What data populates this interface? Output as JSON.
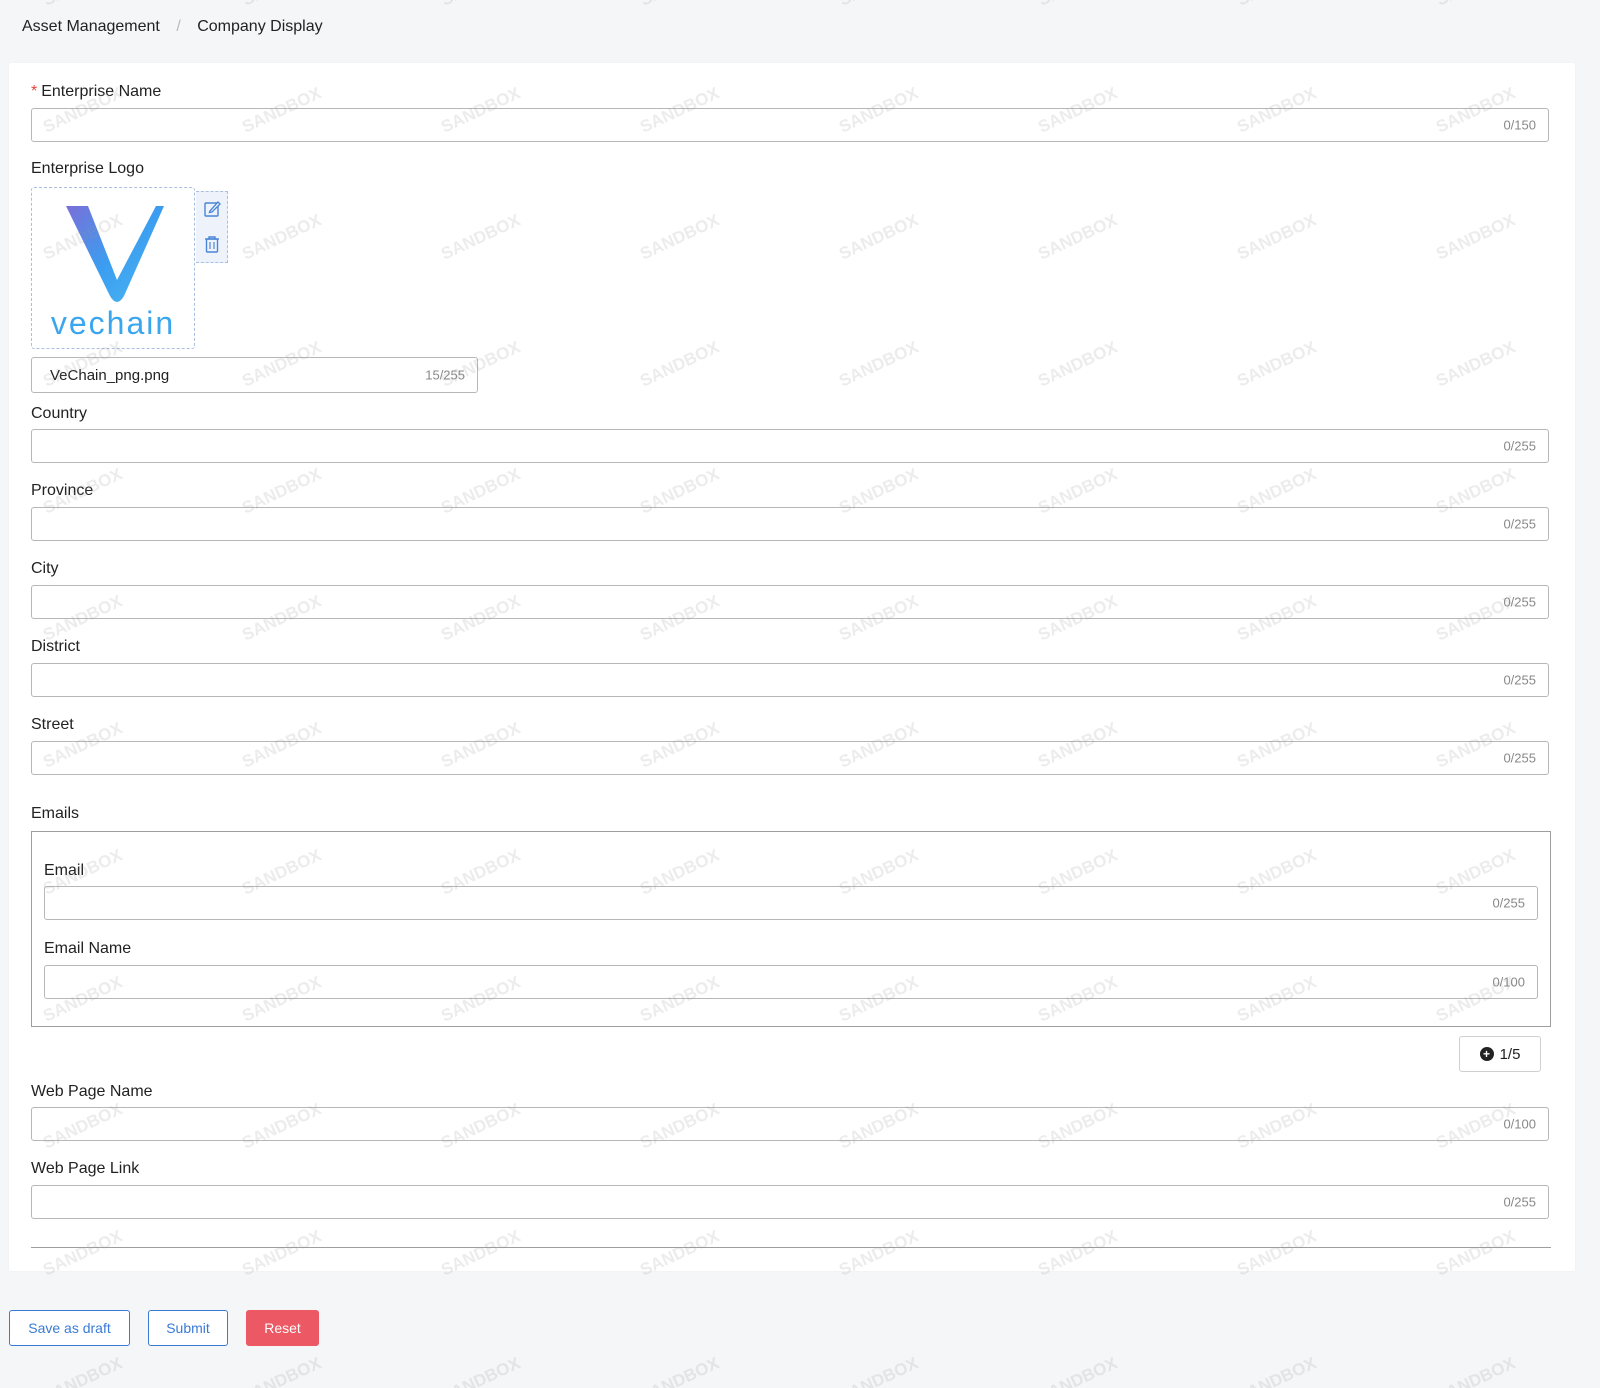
{
  "breadcrumb": {
    "items": [
      "Asset Management",
      "Company Display"
    ],
    "separator": "/"
  },
  "form": {
    "enterprise_name": {
      "label": "Enterprise Name",
      "required_mark": "*",
      "value": "",
      "counter": "0/150"
    },
    "enterprise_logo": {
      "label": "Enterprise Logo",
      "logo_text": "vechain",
      "filename": "VeChain_png.png",
      "counter": "15/255"
    },
    "country": {
      "label": "Country",
      "value": "",
      "counter": "0/255"
    },
    "province": {
      "label": "Province",
      "value": "",
      "counter": "0/255"
    },
    "city": {
      "label": "City",
      "value": "",
      "counter": "0/255"
    },
    "district": {
      "label": "District",
      "value": "",
      "counter": "0/255"
    },
    "street": {
      "label": "Street",
      "value": "",
      "counter": "0/255"
    },
    "emails": {
      "label": "Emails",
      "email": {
        "label": "Email",
        "value": "",
        "counter": "0/255"
      },
      "email_name": {
        "label": "Email Name",
        "value": "",
        "counter": "0/100"
      },
      "add_counter": "1/5"
    },
    "web_page_name": {
      "label": "Web Page Name",
      "value": "",
      "counter": "0/100"
    },
    "web_page_link": {
      "label": "Web Page Link",
      "value": "",
      "counter": "0/255"
    }
  },
  "actions": {
    "save_draft": "Save as draft",
    "submit": "Submit",
    "reset": "Reset"
  },
  "watermark_text": "SANDBOX",
  "colors": {
    "primary": "#3a7bd5",
    "danger": "#ec5863",
    "required": "#e0463f"
  }
}
